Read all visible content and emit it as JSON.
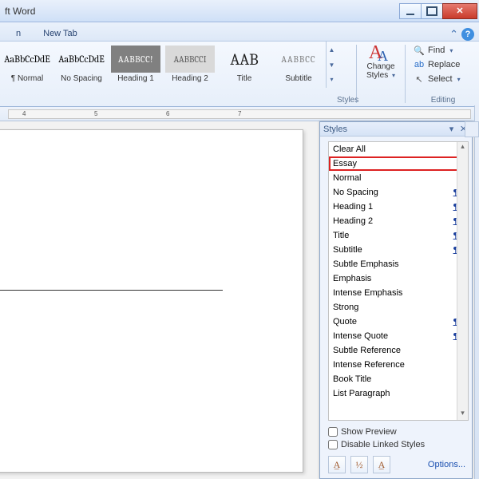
{
  "title_fragment": "ft Word",
  "tabs": {
    "a": "n",
    "b": "New Tab"
  },
  "gallery": [
    {
      "preview": "AaBbCcDdE",
      "cls": "body",
      "label": "¶ Normal"
    },
    {
      "preview": "AaBbCcDdE",
      "cls": "body",
      "label": "No Spacing"
    },
    {
      "preview": "AABBCC!",
      "cls": "h1",
      "label": "Heading 1"
    },
    {
      "preview": "AABBCCI",
      "cls": "h2",
      "label": "Heading 2"
    },
    {
      "preview": "AAB",
      "cls": "titlep",
      "label": "Title"
    },
    {
      "preview": "AABBCC",
      "cls": "subtitlep",
      "label": "Subtitle"
    }
  ],
  "ribbon_group_styles": "Styles",
  "change_styles_label": "Change Styles",
  "editing": {
    "find": "Find",
    "replace": "Replace",
    "select": "Select",
    "caption": "Editing"
  },
  "ruler_nums": [
    "4",
    "5",
    "6",
    "7"
  ],
  "pane": {
    "title": "Styles",
    "items": [
      {
        "name": "Clear All",
        "glyph": ""
      },
      {
        "name": "Essay",
        "glyph": "para",
        "sel": true
      },
      {
        "name": "Normal",
        "glyph": "para"
      },
      {
        "name": "No Spacing",
        "glyph": "linked"
      },
      {
        "name": "Heading 1",
        "glyph": "linked"
      },
      {
        "name": "Heading 2",
        "glyph": "linked"
      },
      {
        "name": "Title",
        "glyph": "linked"
      },
      {
        "name": "Subtitle",
        "glyph": "linked"
      },
      {
        "name": "Subtle Emphasis",
        "glyph": "char"
      },
      {
        "name": "Emphasis",
        "glyph": "char"
      },
      {
        "name": "Intense Emphasis",
        "glyph": "char"
      },
      {
        "name": "Strong",
        "glyph": "char"
      },
      {
        "name": "Quote",
        "glyph": "linked"
      },
      {
        "name": "Intense Quote",
        "glyph": "linked"
      },
      {
        "name": "Subtle Reference",
        "glyph": "char"
      },
      {
        "name": "Intense Reference",
        "glyph": "char"
      },
      {
        "name": "Book Title",
        "glyph": "char"
      },
      {
        "name": "List Paragraph",
        "glyph": "para"
      }
    ],
    "show_preview": "Show Preview",
    "disable_linked": "Disable Linked Styles",
    "options": "Options..."
  }
}
